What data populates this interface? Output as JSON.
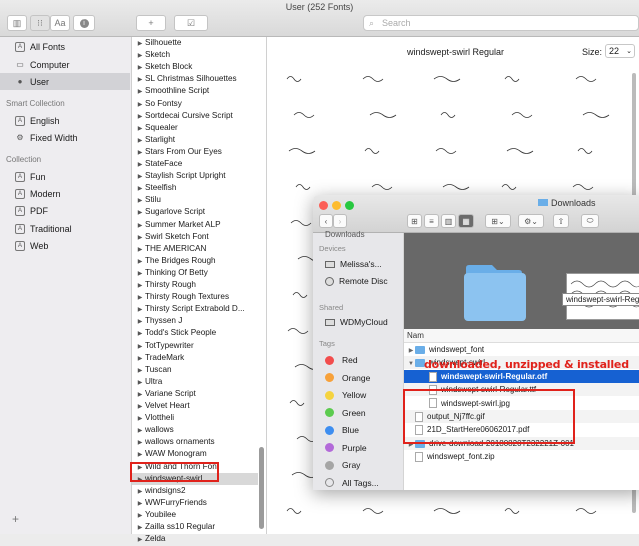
{
  "window": {
    "title": "User (252 Fonts)"
  },
  "toolbar": {
    "add_label": "+",
    "check_label": "☑",
    "search_placeholder": "Search",
    "text_view_label": "Aa"
  },
  "sidebar": {
    "library_items": [
      {
        "label": "All Fonts",
        "icon": "font-book-icon"
      },
      {
        "label": "Computer",
        "icon": "computer-icon"
      },
      {
        "label": "User",
        "icon": "user-icon"
      }
    ],
    "smart_heading": "Smart Collection",
    "smart_items": [
      {
        "label": "English",
        "icon": "collection-icon"
      },
      {
        "label": "Fixed Width",
        "icon": "gear-icon"
      }
    ],
    "collection_heading": "Collection",
    "collection_items": [
      {
        "label": "Fun"
      },
      {
        "label": "Modern"
      },
      {
        "label": "PDF"
      },
      {
        "label": "Traditional"
      },
      {
        "label": "Web"
      }
    ],
    "add_label": "+"
  },
  "font_list": [
    "Silhouette",
    "Sketch",
    "Sketch Block",
    "SL Christmas Silhouettes",
    "Smoothline Script",
    "So Fontsy",
    "Sortdecai Cursive Script",
    "Squealer",
    "Starlight",
    "Stars From Our Eyes",
    "StateFace",
    "Staylish Script Upright",
    "Steelfish",
    "Stilu",
    "Sugarlove Script",
    "Summer Market ALP",
    "Swirl Sketch Font",
    "THE AMERICAN",
    "The Bridges Rough",
    "Thinking Of Betty",
    "Thirsty Rough",
    "Thirsty Rough Textures",
    "Thirsty Script Extrabold D...",
    "Thyssen J",
    "Todd's Stick People",
    "TotTypewriter",
    "TradeMark",
    "Tuscan",
    "Ultra",
    "Variane Script",
    "Velvet Heart",
    "Vlottheli",
    "wallows",
    "wallows ornaments",
    "WAW Monogram",
    "Wild and Thorn Font",
    "windswept-swirl",
    "windsigns2",
    "WWFurryFriends",
    "Youbilee",
    "Zailla ss10 Regular",
    "Zelda"
  ],
  "selected_font": "windswept-swirl",
  "preview": {
    "title": "windswept-swirl Regular",
    "size_label": "Size:",
    "size_value": "22"
  },
  "finder": {
    "title": "Downloads",
    "sidebar_top_partial": "Downloads",
    "devices_heading": "Devices",
    "devices": [
      "Melissa's...",
      "Remote Disc"
    ],
    "shared_heading": "Shared",
    "shared": [
      "WDMyCloud"
    ],
    "tags_heading": "Tags",
    "tags": [
      {
        "label": "Red",
        "color": "#f24d4d"
      },
      {
        "label": "Orange",
        "color": "#f7a13a"
      },
      {
        "label": "Yellow",
        "color": "#f5d33f"
      },
      {
        "label": "Green",
        "color": "#5ccb4f"
      },
      {
        "label": "Blue",
        "color": "#3e8ef0"
      },
      {
        "label": "Purple",
        "color": "#b36ad9"
      },
      {
        "label": "Gray",
        "color": "#a5a5a5"
      },
      {
        "label": "All Tags...",
        "color": ""
      }
    ],
    "preview_caption": "windswept-swirl-Reg",
    "column_header": "Nam",
    "files": [
      {
        "name": "windswept_font",
        "kind": "folder",
        "level": 0,
        "disclosure": "▶"
      },
      {
        "name": "windswept-swirl",
        "kind": "folder",
        "level": 0,
        "disclosure": "▼"
      },
      {
        "name": "windswept-swirl-Regular.otf",
        "kind": "doc",
        "level": 1,
        "disclosure": ""
      },
      {
        "name": "windswept-swirl-Regular.ttf",
        "kind": "doc",
        "level": 1,
        "disclosure": ""
      },
      {
        "name": "windswept-swirl.jpg",
        "kind": "doc",
        "level": 1,
        "disclosure": ""
      },
      {
        "name": "output_Nj7ffc.gif",
        "kind": "doc",
        "level": 0,
        "disclosure": ""
      },
      {
        "name": "21D_StartHere06062017.pdf",
        "kind": "doc",
        "level": 0,
        "disclosure": ""
      },
      {
        "name": "drive-download-20180820T232221Z-001",
        "kind": "folder",
        "level": 0,
        "disclosure": "▶"
      },
      {
        "name": "windswept_font.zip",
        "kind": "doc",
        "level": 0,
        "disclosure": ""
      }
    ],
    "selected_file": "windswept-swirl-Regular.otf"
  },
  "annotation": "downloaded, unzipped & installed",
  "colors": {
    "highlight": "#e0221b",
    "selection": "#1661d2"
  }
}
